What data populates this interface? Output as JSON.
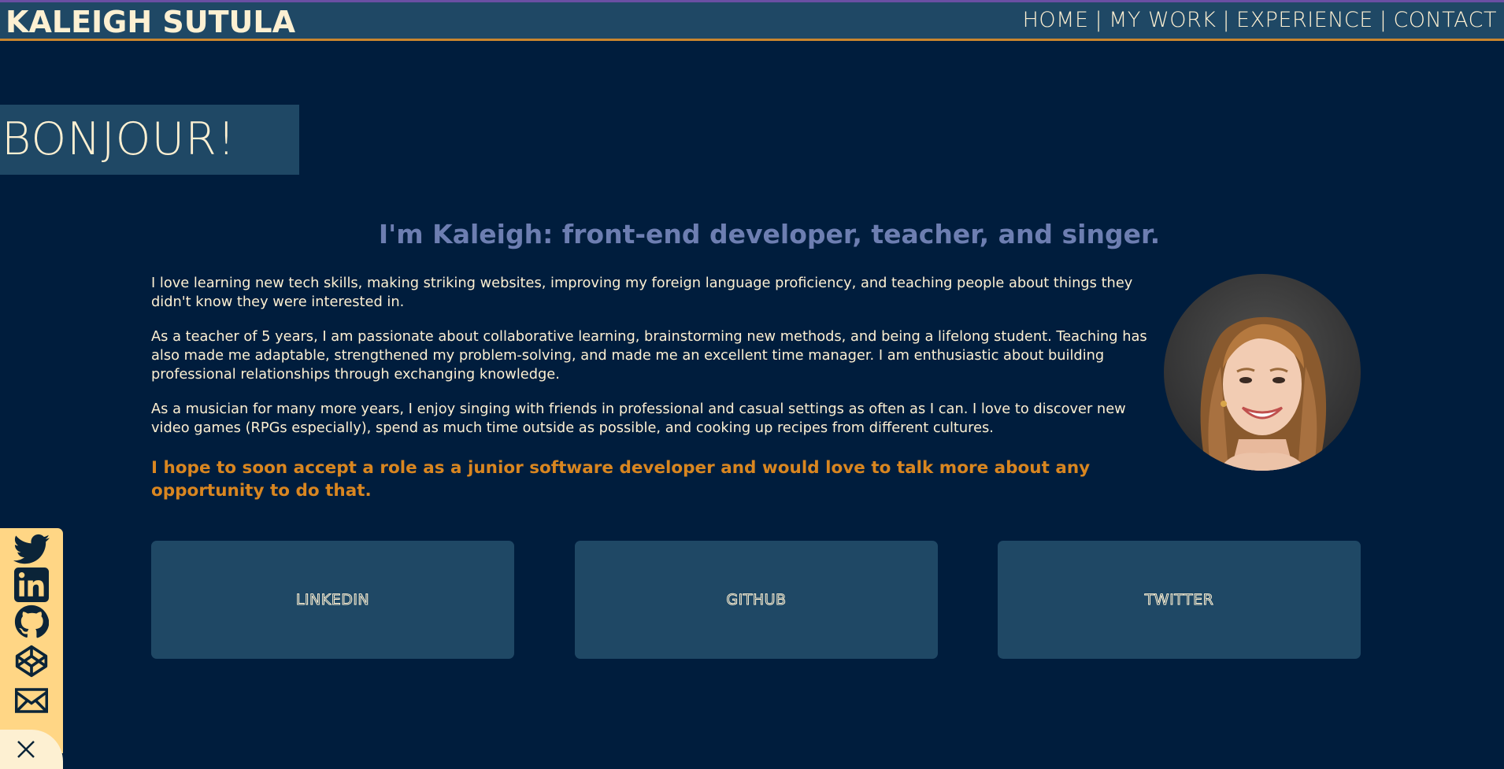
{
  "header": {
    "brand": "KALEIGH SUTULA",
    "nav": [
      {
        "label": "HOME",
        "sep": "|"
      },
      {
        "label": "MY WORK",
        "sep": "|"
      },
      {
        "label": "EXPERIENCE",
        "sep": "|"
      },
      {
        "label": "CONTACT",
        "sep": ""
      }
    ]
  },
  "hero": {
    "greeting": "BONJOUR!"
  },
  "about": {
    "tagline": "I'm Kaleigh: front-end developer, teacher, and singer.",
    "paragraphs": [
      "I love learning new tech skills, making striking websites, improving my foreign language proficiency, and teaching people about things they didn't know they were interested in.",
      "As a teacher of 5 years, I am passionate about collaborative learning, brainstorming new methods, and being a lifelong student. Teaching has also made me adaptable, strengthened my problem-solving, and made me an excellent time manager. I am enthusiastic about building professional relationships through exchanging knowledge.",
      "As a musician for many more years, I enjoy singing with friends in professional and casual settings as often as I can. I love to discover new video games (RPGs especially), spend as much time outside as possible, and cooking up recipes from different cultures."
    ],
    "goal": "I hope to soon accept a role as a junior software developer and would love to talk more about any opportunity to do that."
  },
  "links": {
    "cards": [
      {
        "label": "LINKEDIN"
      },
      {
        "label": "GITHUB"
      },
      {
        "label": "TWITTER"
      }
    ]
  },
  "social_bar": {
    "icons": [
      "twitter-icon",
      "linkedin-icon",
      "github-icon",
      "codepen-icon",
      "mail-icon"
    ],
    "close_icon": "close-icon"
  },
  "colors": {
    "background": "#001d3d",
    "panel": "#1f4865",
    "cream": "#fdf0d2",
    "tagline": "#6d7eb1",
    "accent_orange": "#d98620",
    "social_bg": "#ffd685"
  }
}
